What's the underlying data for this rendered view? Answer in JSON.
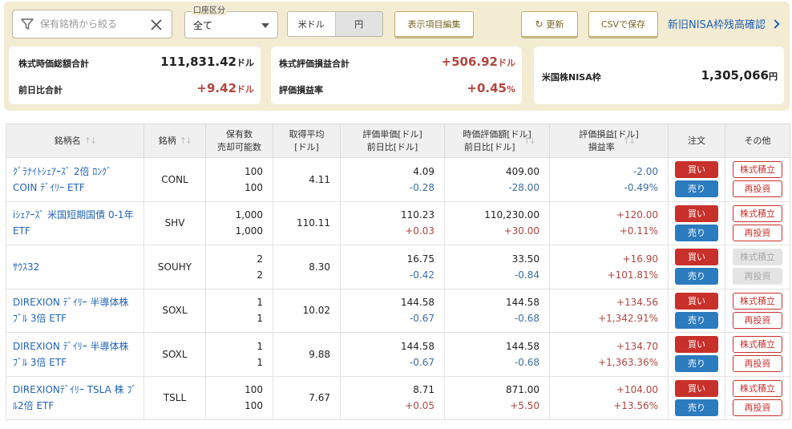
{
  "filter": {
    "placeholder": "保有銘柄から絞る"
  },
  "account": {
    "label": "口座区分",
    "value": "全て"
  },
  "currency": {
    "usd": "米ドル",
    "jpy": "円"
  },
  "buttons": {
    "edit_columns": "表示項目編集",
    "refresh": "更新",
    "csv": "CSVで保存",
    "nisa_link": "新旧NISA枠残高確認"
  },
  "summary": {
    "market_value_label": "株式時価総額合計",
    "market_value": "111,831.42",
    "market_value_unit": "ドル",
    "day_change_label": "前日比合計",
    "day_change": "+9.42",
    "day_change_unit": "ドル",
    "pl_label": "株式評価損益合計",
    "pl": "+506.92",
    "pl_unit": "ドル",
    "pl_rate_label": "評価損益率",
    "pl_rate": "+0.45",
    "pl_rate_unit": "%",
    "nisa_label": "米国株NISA枠",
    "nisa_value": "1,305,066",
    "nisa_unit": "円"
  },
  "table": {
    "headers": {
      "name": "銘柄名",
      "code": "銘柄",
      "qty_1": "保有数",
      "qty_2": "売却可能数",
      "avg_1": "取得平均",
      "avg_2": "[ドル]",
      "price_1": "評価単価[ドル]",
      "price_2": "前日比[ドル]",
      "mv_1": "時価評価額[ドル]",
      "mv_2": "前日比[ドル]",
      "pl_1": "評価損益[ドル]",
      "pl_2": "損益率",
      "order": "注文",
      "other": "その他"
    },
    "buy_label": "買い",
    "sell_label": "売り",
    "accum_label": "株式積立",
    "reinvest_label": "再投資",
    "rows": [
      {
        "name_1": "ｸﾞﾗﾅｲﾄｼｪｱｰｽﾞ 2倍 ﾛﾝｸﾞ",
        "name_2": "COIN ﾃﾞｲﾘｰ ETF",
        "code": "CONL",
        "qty": "100",
        "sellable": "100",
        "avg": "4.11",
        "price": "4.09",
        "price_chg": "-0.28",
        "mv": "409.00",
        "mv_chg": "-28.00",
        "pl": "-2.00",
        "pl_rate": "-0.49%"
      },
      {
        "name_1": "iｼｪｱｰｽﾞ 米国短期国債 0-1年",
        "name_2": "ETF",
        "code": "SHV",
        "qty": "1,000",
        "sellable": "1,000",
        "avg": "110.11",
        "price": "110.23",
        "price_chg": "+0.03",
        "mv": "110,230.00",
        "mv_chg": "+30.00",
        "pl": "+120.00",
        "pl_rate": "+0.11%"
      },
      {
        "name_1": "ｻｳｽ32",
        "name_2": "",
        "code": "SOUHY",
        "qty": "2",
        "sellable": "2",
        "avg": "8.30",
        "price": "16.75",
        "price_chg": "-0.42",
        "mv": "33.50",
        "mv_chg": "-0.84",
        "pl": "+16.90",
        "pl_rate": "+101.81%"
      },
      {
        "name_1": "DIREXION ﾃﾞｲﾘｰ 半導体株",
        "name_2": "ﾌﾞﾙ 3倍 ETF",
        "code": "SOXL",
        "qty": "1",
        "sellable": "1",
        "avg": "10.02",
        "price": "144.58",
        "price_chg": "-0.67",
        "mv": "144.58",
        "mv_chg": "-0.68",
        "pl": "+134.56",
        "pl_rate": "+1,342.91%"
      },
      {
        "name_1": "DIREXION ﾃﾞｲﾘｰ 半導体株",
        "name_2": "ﾌﾞﾙ 3倍 ETF",
        "code": "SOXL",
        "qty": "1",
        "sellable": "1",
        "avg": "9.88",
        "price": "144.58",
        "price_chg": "-0.67",
        "mv": "144.58",
        "mv_chg": "-0.68",
        "pl": "+134.70",
        "pl_rate": "+1,363.36%"
      },
      {
        "name_1": "DIREXIONﾃﾞｲﾘｰ TSLA 株 ﾌﾞ",
        "name_2": "ﾙ2倍 ETF",
        "code": "TSLL",
        "qty": "100",
        "sellable": "100",
        "avg": "7.67",
        "price": "8.71",
        "price_chg": "+0.05",
        "mv": "871.00",
        "mv_chg": "+5.50",
        "pl": "+104.00",
        "pl_rate": "+13.56%"
      }
    ]
  }
}
